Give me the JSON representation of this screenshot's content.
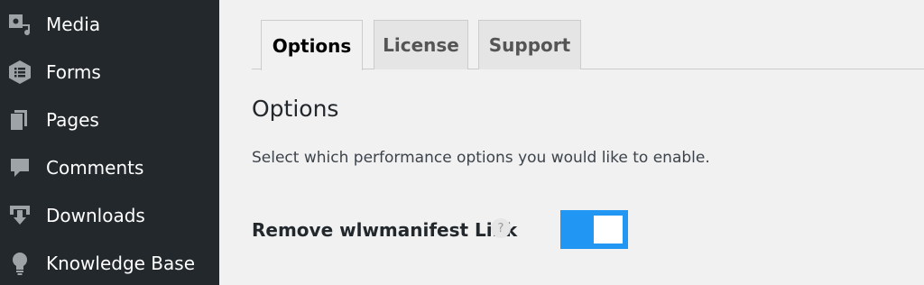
{
  "sidebar": {
    "items": [
      {
        "label": "Media",
        "icon": "media-icon"
      },
      {
        "label": "Forms",
        "icon": "forms-icon"
      },
      {
        "label": "Pages",
        "icon": "pages-icon"
      },
      {
        "label": "Comments",
        "icon": "comments-icon"
      },
      {
        "label": "Downloads",
        "icon": "downloads-icon"
      },
      {
        "label": "Knowledge Base",
        "icon": "lightbulb-icon"
      }
    ]
  },
  "tabs": [
    {
      "label": "Options",
      "active": true
    },
    {
      "label": "License",
      "active": false
    },
    {
      "label": "Support",
      "active": false
    }
  ],
  "main": {
    "title": "Options",
    "description": "Select which performance options you would like to enable.",
    "option": {
      "label": "Remove wlwmanifest Link",
      "help": "?",
      "enabled": true
    }
  },
  "colors": {
    "sidebar_bg": "#23282d",
    "page_bg": "#f1f1f1",
    "accent": "#2196f3"
  }
}
